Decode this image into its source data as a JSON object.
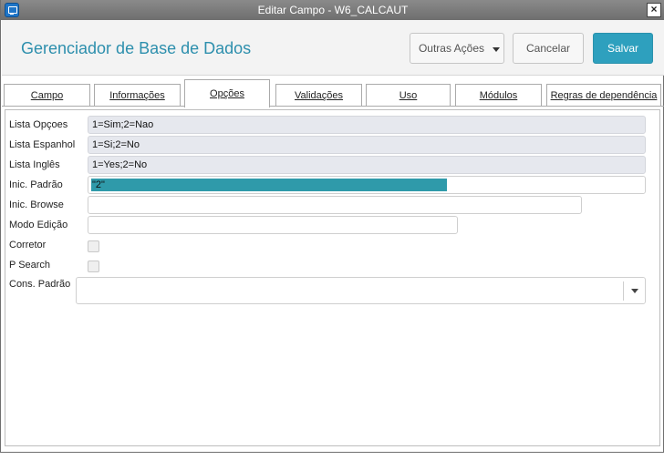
{
  "window": {
    "title": "Editar Campo - W6_CALCAUT"
  },
  "header": {
    "title": "Gerenciador de Base de Dados",
    "buttons": {
      "outras_acoes": "Outras Ações",
      "cancelar": "Cancelar",
      "salvar": "Salvar"
    },
    "accent_color": "#2ea0be"
  },
  "tabs": [
    {
      "label": "Campo",
      "active": false
    },
    {
      "label": "Informações",
      "active": false
    },
    {
      "label": "Opções",
      "active": true
    },
    {
      "label": "Validações",
      "active": false
    },
    {
      "label": "Uso",
      "active": false
    },
    {
      "label": "Módulos",
      "active": false
    },
    {
      "label": "Regras de dependência",
      "active": false
    }
  ],
  "form": {
    "lista_opcoes": {
      "label": "Lista Opçoes",
      "value": "1=Sim;2=Nao"
    },
    "lista_espanhol": {
      "label": "Lista Espanhol",
      "value": "1=Si;2=No"
    },
    "lista_ingles": {
      "label": "Lista Inglês",
      "value": "1=Yes;2=No"
    },
    "inic_padrao": {
      "label": "Inic. Padrão",
      "value": "\"2\""
    },
    "inic_browse": {
      "label": "Inic. Browse",
      "value": ""
    },
    "modo_edicao": {
      "label": "Modo Edição",
      "value": ""
    },
    "corretor": {
      "label": "Corretor",
      "checked": false
    },
    "p_search": {
      "label": "P Search",
      "checked": false
    },
    "cons_padrao": {
      "label": "Cons. Padrão",
      "value": ""
    }
  },
  "icons": {
    "app": "app-window-icon",
    "close": "close-icon",
    "dropdown": "chevron-down-icon"
  }
}
